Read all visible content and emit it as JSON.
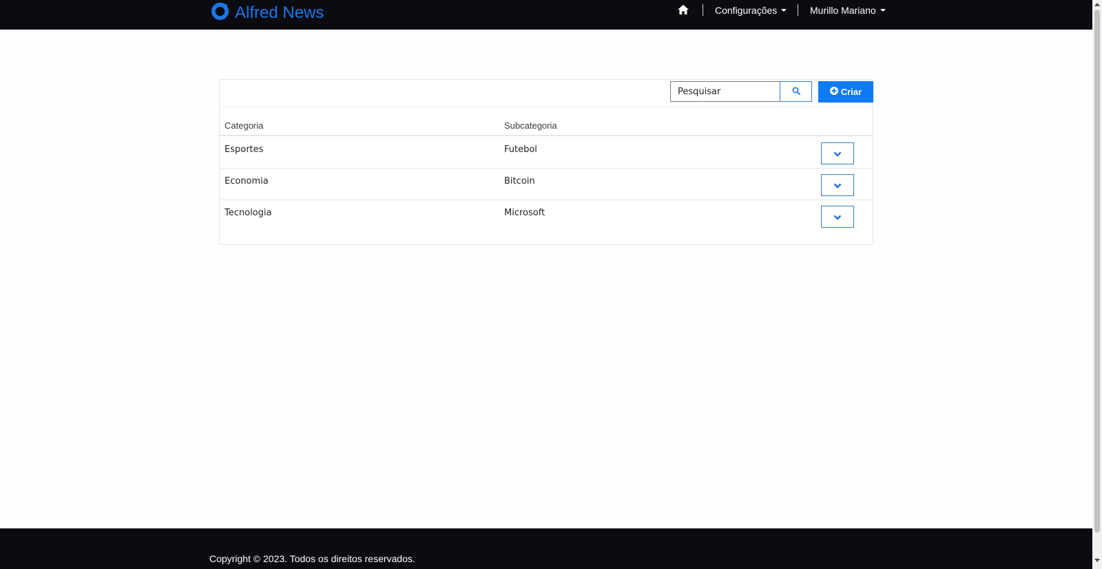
{
  "header": {
    "brand": "Alfred News",
    "icons": {
      "logo": "logo-ring-icon",
      "home": "home-icon",
      "caret": "caret-down-icon"
    },
    "menu": {
      "settings_label": "Configurações",
      "user_label": "Murillo Mariano"
    }
  },
  "toolbar": {
    "search_value": "Pesquisar",
    "search_icon": "search-icon",
    "create_label": "Criar",
    "create_icon": "plus-circle-icon"
  },
  "table": {
    "columns": [
      "Categoria",
      "Subcategoria"
    ],
    "rows": [
      {
        "categoria": "Esportes",
        "subcategoria": "Futebol"
      },
      {
        "categoria": "Economia",
        "subcategoria": "Bitcoin"
      },
      {
        "categoria": "Tecnologia",
        "subcategoria": "Microsoft"
      }
    ],
    "row_action_icon": "chevron-down-icon"
  },
  "footer": {
    "copyright": "Copyright © 2023. Todos os direitos reservados."
  },
  "colors": {
    "navbar_bg": "#0a0c11",
    "brand": "#1d76e6",
    "primary": "#0d7cf2",
    "outline": "#2f7fd9"
  }
}
